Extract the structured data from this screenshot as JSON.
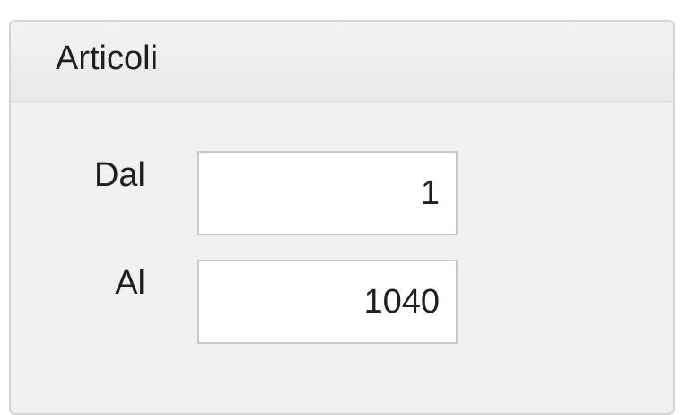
{
  "group": {
    "title": "Articoli"
  },
  "fields": {
    "from": {
      "label": "Dal",
      "value": "1"
    },
    "to": {
      "label": "Al",
      "value": "1040"
    }
  }
}
